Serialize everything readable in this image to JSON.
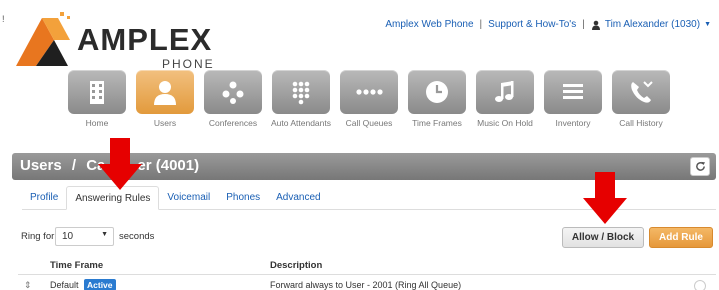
{
  "corner_mark": "!",
  "logo": {
    "name": "AMPLEX",
    "sub": "PHONE"
  },
  "header": {
    "links": [
      "Amplex Web Phone",
      "Support & How-To's"
    ],
    "user": "Tim Alexander (1030)"
  },
  "nav": [
    {
      "label": "Home",
      "icon": "building-icon",
      "active": false
    },
    {
      "label": "Users",
      "icon": "user-icon",
      "active": true
    },
    {
      "label": "Conferences",
      "icon": "conference-icon",
      "active": false
    },
    {
      "label": "Auto Attendants",
      "icon": "keypad-icon",
      "active": false
    },
    {
      "label": "Call Queues",
      "icon": "queue-dots-icon",
      "active": false
    },
    {
      "label": "Time Frames",
      "icon": "clock-icon",
      "active": false
    },
    {
      "label": "Music On Hold",
      "icon": "music-note-icon",
      "active": false
    },
    {
      "label": "Inventory",
      "icon": "list-icon",
      "active": false
    },
    {
      "label": "Call History",
      "icon": "phone-history-icon",
      "active": false
    }
  ],
  "page": {
    "title_prefix": "Users",
    "title_sep": "/",
    "title_user_left": "Ca",
    "title_user_right": "er (4001)"
  },
  "tabs": [
    "Profile",
    "Answering Rules",
    "Voicemail",
    "Phones",
    "Advanced"
  ],
  "active_tab": "Answering Rules",
  "ring": {
    "label": "Ring for",
    "value": "10",
    "unit": "seconds"
  },
  "buttons": {
    "allow_block": "Allow / Block",
    "add_rule": "Add Rule"
  },
  "table": {
    "headers": [
      "Time Frame",
      "Description"
    ],
    "rows": [
      {
        "time_frame": "Default",
        "status": "Active",
        "description": "Forward always to User - 2001 (Ring All Queue)"
      }
    ]
  },
  "colors": {
    "accent": "#e6983a",
    "link": "#1a5fb4",
    "badge": "#2a7bd0",
    "arrow": "#e60000"
  }
}
